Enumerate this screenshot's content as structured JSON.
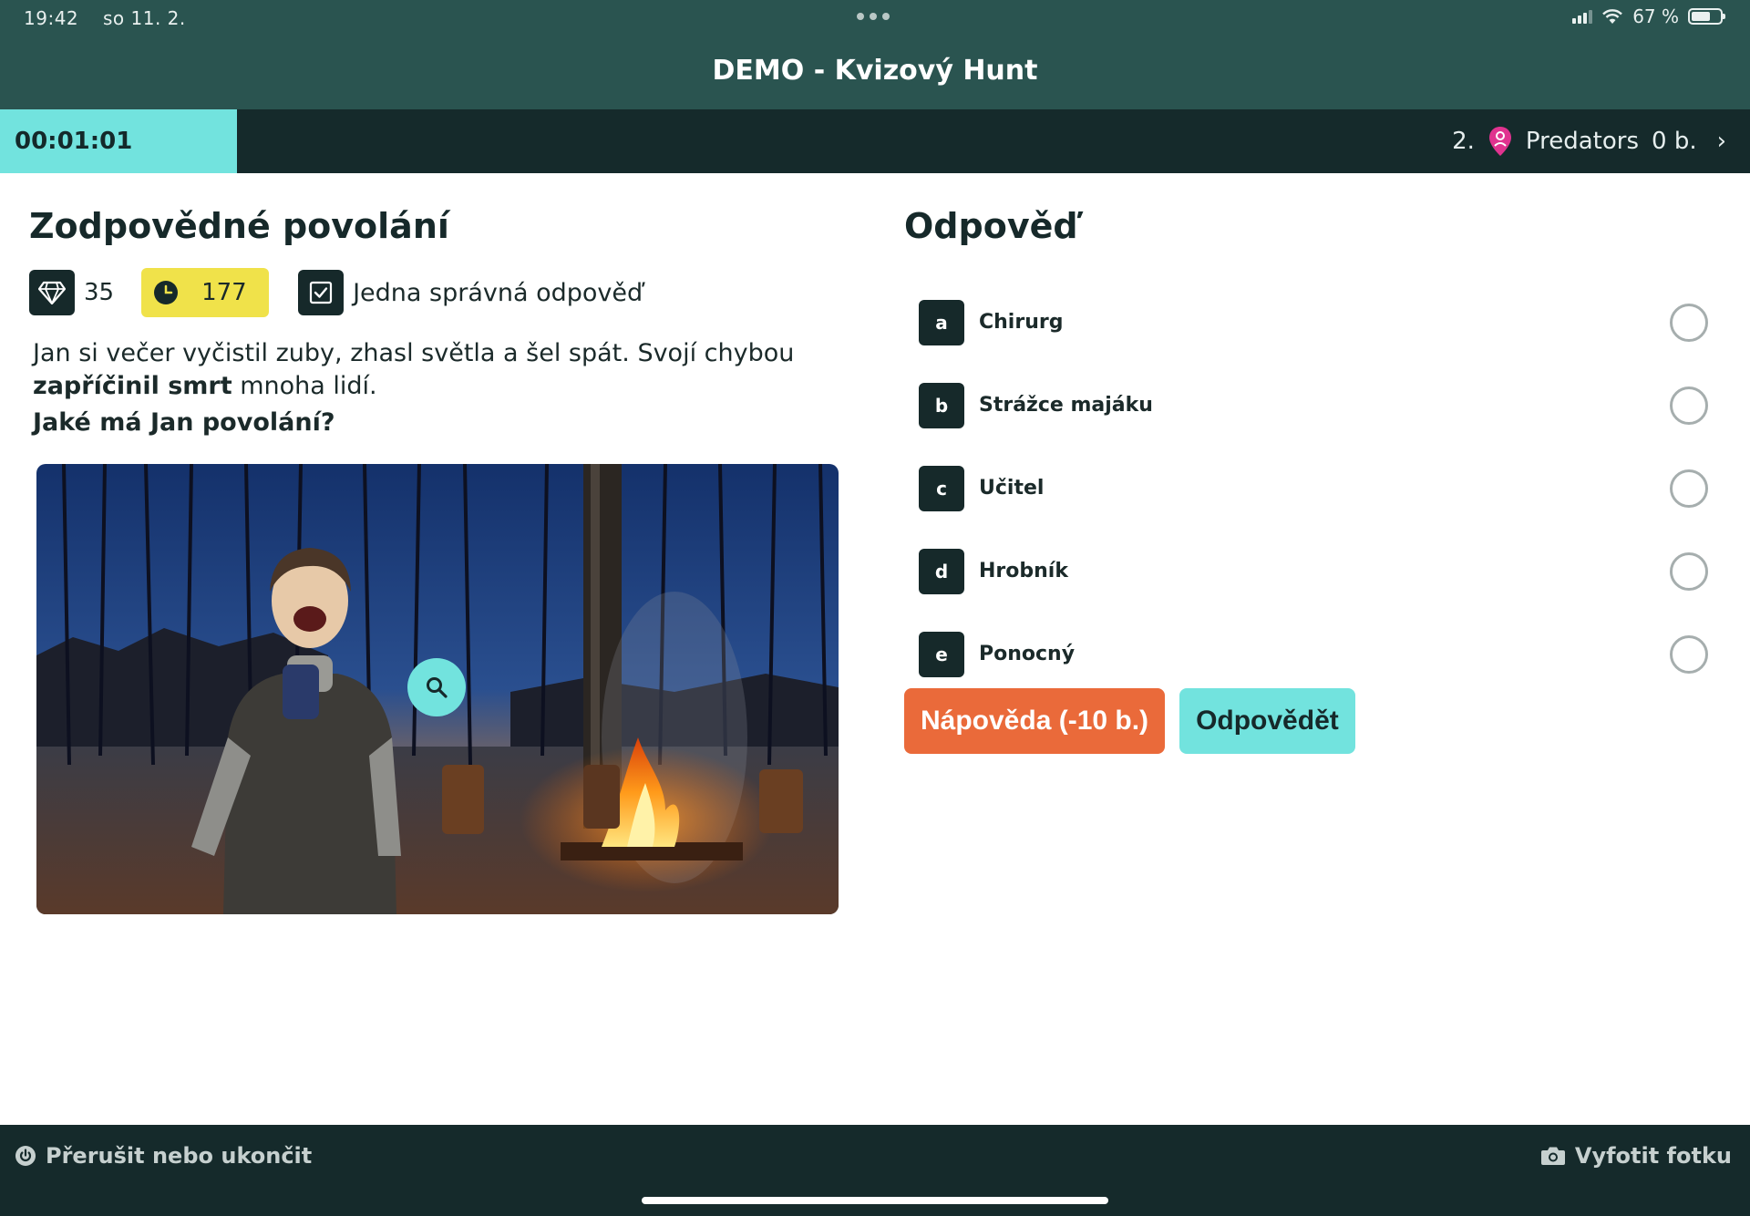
{
  "status": {
    "time": "19:42",
    "date": "so 11. 2.",
    "battery": "67 %",
    "battery_level": 0.67
  },
  "header": {
    "title": "DEMO - Kvizový Hunt"
  },
  "timerbar": {
    "timer": "00:01:01",
    "rank": "2.",
    "team": "Predators",
    "score": "0 b."
  },
  "question": {
    "title": "Zodpovědné povolání",
    "points": "35",
    "time_limit": "177",
    "type": "Jedna správná odpověď",
    "text_part1": "Jan si večer vyčistil zuby, zhasl světla a šel spát. Svojí chybou ",
    "text_bold": "zapříčinil smrt",
    "text_part2": " mnoha lidí.",
    "ask": "Jaké má Jan povolání?"
  },
  "answers": {
    "title": "Odpověď",
    "items": [
      {
        "letter": "a",
        "label": "Chirurg"
      },
      {
        "letter": "b",
        "label": "Strážce majáku"
      },
      {
        "letter": "c",
        "label": "Učitel"
      },
      {
        "letter": "d",
        "label": "Hrobník"
      },
      {
        "letter": "e",
        "label": "Ponocný"
      }
    ]
  },
  "actions": {
    "hint": "Nápověda (-10 b.)",
    "answer": "Odpovědět"
  },
  "footer": {
    "quit": "Přerušit nebo ukončit",
    "photo": "Vyfotit fotku"
  },
  "colors": {
    "header_bg": "#2a5450",
    "dark": "#152a2b",
    "accent": "#72e3de",
    "time_badge": "#f0e24a",
    "hint_button": "#ea6a3a",
    "pin": "#e0338f"
  }
}
